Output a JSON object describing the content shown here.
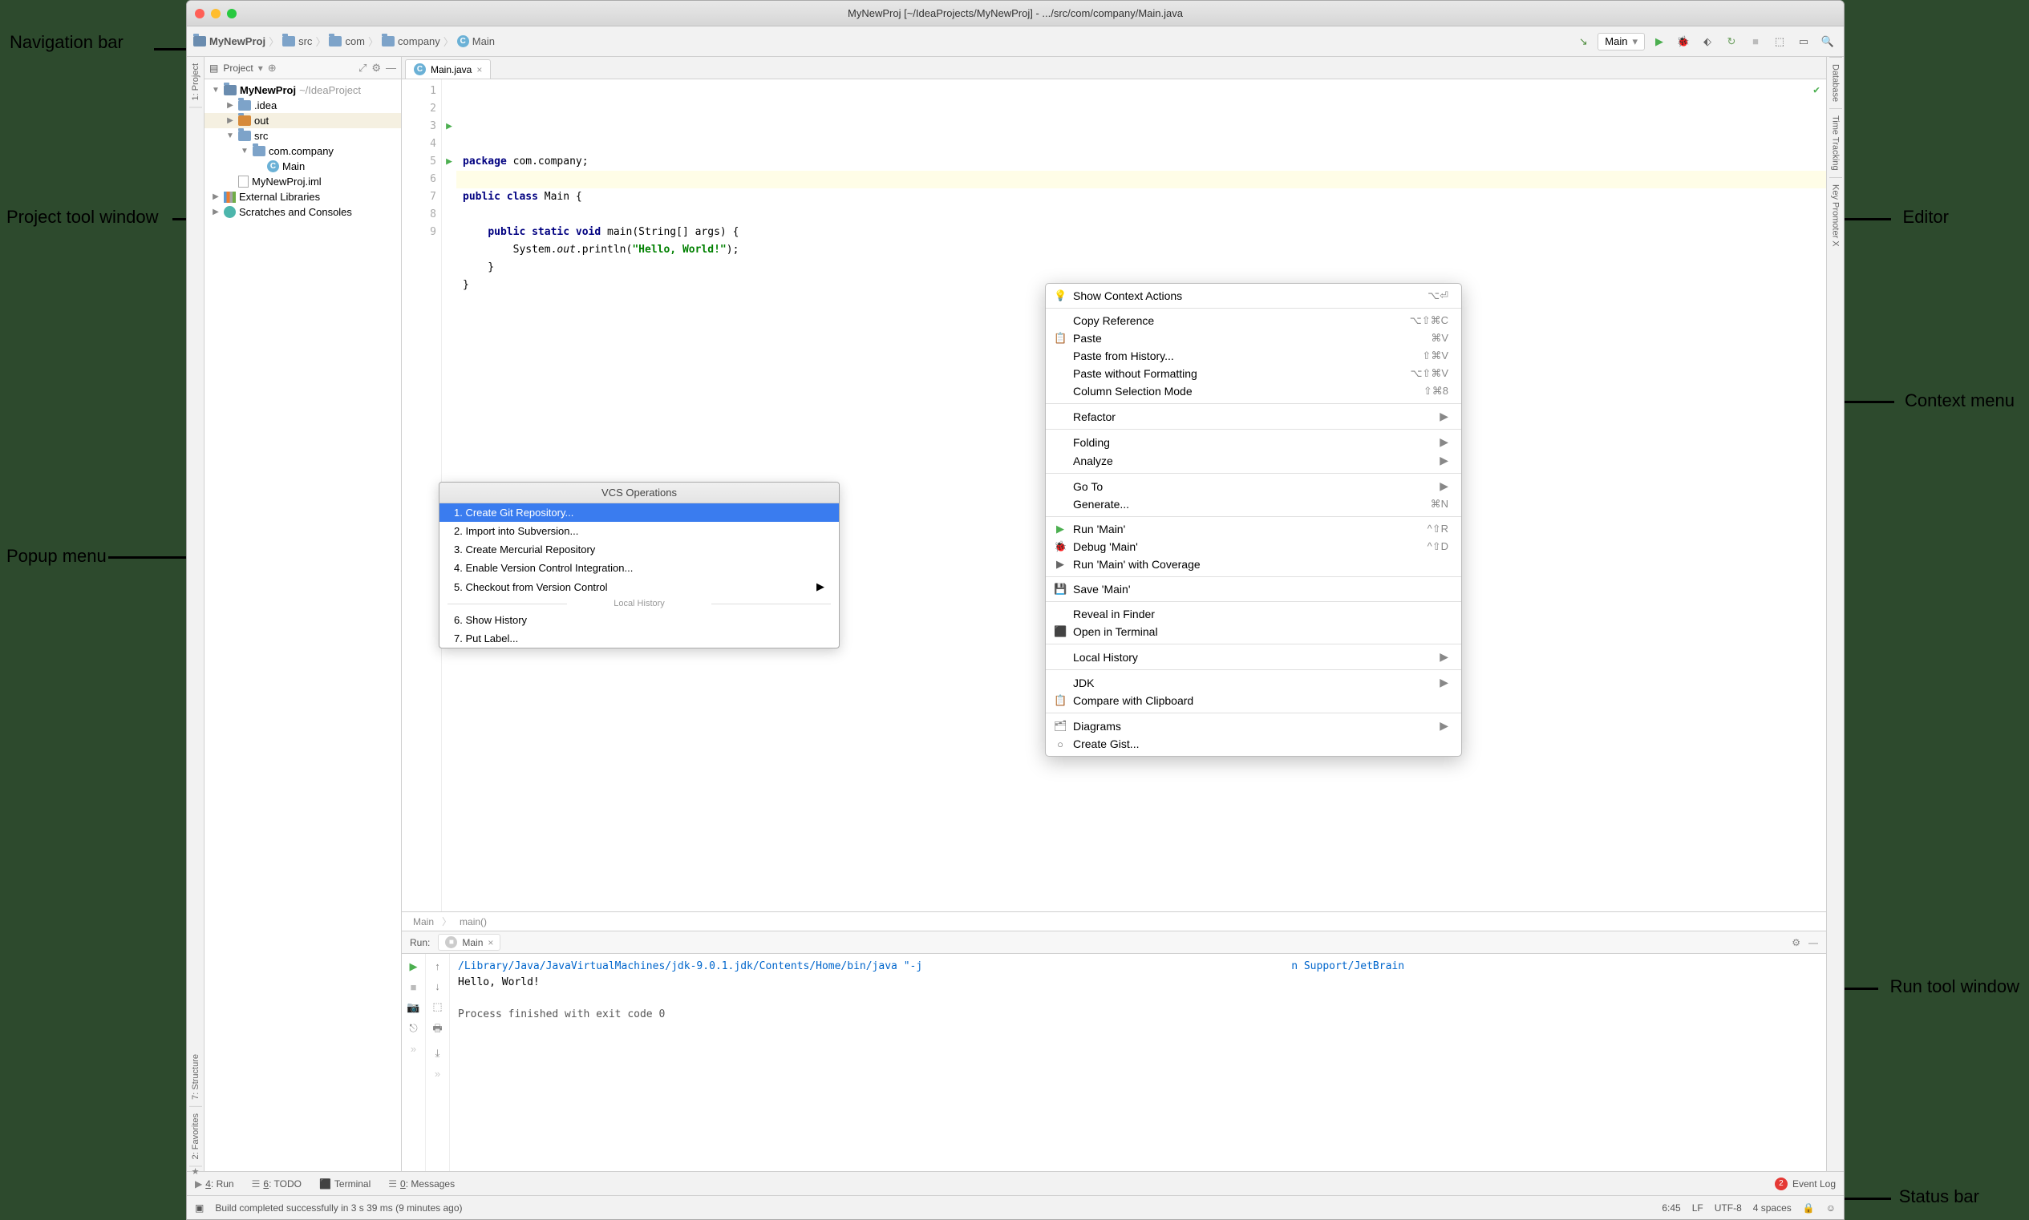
{
  "window": {
    "title": "MyNewProj [~/IdeaProjects/MyNewProj] - .../src/com/company/Main.java"
  },
  "annotations": {
    "nav_bar": "Navigation bar",
    "project_tool": "Project tool window",
    "popup_menu": "Popup menu",
    "editor": "Editor",
    "context_menu": "Context menu",
    "run_tool": "Run tool window",
    "status_bar": "Status bar"
  },
  "breadcrumbs": [
    {
      "icon": "folder-proj",
      "label": "MyNewProj",
      "bold": true
    },
    {
      "icon": "folder",
      "label": "src"
    },
    {
      "icon": "folder",
      "label": "com"
    },
    {
      "icon": "folder",
      "label": "company"
    },
    {
      "icon": "class",
      "label": "Main"
    }
  ],
  "run_config_label": "Main",
  "left_tabs": [
    "1: Project",
    "7: Structure",
    "2: Favorites"
  ],
  "right_tabs": [
    "Database",
    "Time Tracking",
    "Key Promoter X"
  ],
  "project_panel": {
    "title": "Project",
    "tree": [
      {
        "depth": 0,
        "arrow": "▼",
        "icon": "folder-proj",
        "label": "MyNewProj",
        "bold": true,
        "path": "~/IdeaProject"
      },
      {
        "depth": 1,
        "arrow": "▶",
        "icon": "folder",
        "label": ".idea"
      },
      {
        "depth": 1,
        "arrow": "▶",
        "icon": "folder-orange",
        "label": "out",
        "selected": true
      },
      {
        "depth": 1,
        "arrow": "▼",
        "icon": "folder",
        "label": "src"
      },
      {
        "depth": 2,
        "arrow": "▼",
        "icon": "folder",
        "label": "com.company"
      },
      {
        "depth": 3,
        "arrow": "",
        "icon": "class",
        "label": "Main"
      },
      {
        "depth": 1,
        "arrow": "",
        "icon": "file",
        "label": "MyNewProj.iml"
      },
      {
        "depth": 0,
        "arrow": "▶",
        "icon": "lib",
        "label": "External Libraries"
      },
      {
        "depth": 0,
        "arrow": "▶",
        "icon": "scratch",
        "label": "Scratches and Consoles"
      }
    ]
  },
  "editor": {
    "tab_label": "Main.java",
    "close": "×",
    "lines": [
      {
        "n": 1,
        "g": "",
        "html": "<span class='kw'>package</span> com.company;"
      },
      {
        "n": 2,
        "g": "",
        "html": ""
      },
      {
        "n": 3,
        "g": "▶",
        "html": "<span class='kw'>public class</span> Main {"
      },
      {
        "n": 4,
        "g": "",
        "html": ""
      },
      {
        "n": 5,
        "g": "▶",
        "html": "    <span class='kw'>public static void</span> main(String[] args) {"
      },
      {
        "n": 6,
        "g": "",
        "html": "        System.<span class='it'>out</span>.println(<span class='str'>\"Hello, World!\"</span>);",
        "hl": true
      },
      {
        "n": 7,
        "g": "",
        "html": "    }"
      },
      {
        "n": 8,
        "g": "",
        "html": "}"
      },
      {
        "n": 9,
        "g": "",
        "html": ""
      }
    ],
    "breadcrumb": [
      "Main",
      "main()"
    ]
  },
  "popup": {
    "title": "VCS Operations",
    "items": [
      {
        "label": "1. Create Git Repository...",
        "selected": true
      },
      {
        "label": "2. Import into Subversion..."
      },
      {
        "label": "3. Create Mercurial Repository"
      },
      {
        "label": "4. Enable Version Control Integration..."
      },
      {
        "label": "5. Checkout from Version Control",
        "sub": true
      }
    ],
    "sep_label": "Local History",
    "items2": [
      {
        "label": "6. Show History"
      },
      {
        "label": "7. Put Label..."
      }
    ]
  },
  "context_menu": [
    {
      "icon": "💡",
      "label": "Show Context Actions",
      "sc": "⌥⏎"
    },
    {
      "sep": true
    },
    {
      "label": "Copy Reference",
      "sc": "⌥⇧⌘C"
    },
    {
      "icon": "📋",
      "label": "Paste",
      "sc": "⌘V"
    },
    {
      "label": "Paste from History...",
      "sc": "⇧⌘V"
    },
    {
      "label": "Paste without Formatting",
      "sc": "⌥⇧⌘V"
    },
    {
      "label": "Column Selection Mode",
      "sc": "⇧⌘8"
    },
    {
      "sep": true
    },
    {
      "label": "Refactor",
      "sub": true
    },
    {
      "sep": true
    },
    {
      "label": "Folding",
      "sub": true
    },
    {
      "label": "Analyze",
      "sub": true
    },
    {
      "sep": true
    },
    {
      "label": "Go To",
      "sub": true
    },
    {
      "label": "Generate...",
      "sc": "⌘N"
    },
    {
      "sep": true
    },
    {
      "icon": "▶",
      "iconcolor": "#4caf50",
      "label": "Run 'Main'",
      "sc": "^⇧R"
    },
    {
      "icon": "🐞",
      "iconcolor": "#4caf50",
      "label": "Debug 'Main'",
      "sc": "^⇧D"
    },
    {
      "icon": "▶",
      "label": "Run 'Main' with Coverage"
    },
    {
      "sep": true
    },
    {
      "icon": "💾",
      "label": "Save 'Main'"
    },
    {
      "sep": true
    },
    {
      "label": "Reveal in Finder"
    },
    {
      "icon": "⬛",
      "label": "Open in Terminal"
    },
    {
      "sep": true
    },
    {
      "label": "Local History",
      "sub": true
    },
    {
      "sep": true
    },
    {
      "label": "JDK",
      "sub": true
    },
    {
      "icon": "📋",
      "label": "Compare with Clipboard"
    },
    {
      "sep": true
    },
    {
      "icon": "🗂",
      "label": "Diagrams",
      "sub": true
    },
    {
      "icon": "○",
      "label": "Create Gist..."
    }
  ],
  "run": {
    "header_label": "Run:",
    "tab_label": "Main",
    "output_path": "/Library/Java/JavaVirtualMachines/jdk-9.0.1.jdk/Contents/Home/bin/java \"-j",
    "output_path_tail": "n Support/JetBrain",
    "output_hello": "Hello, World!",
    "output_exit": "Process finished with exit code 0"
  },
  "bottom_tools": [
    {
      "icon": "▶",
      "label": "4: Run"
    },
    {
      "icon": "☰",
      "label": "6: TODO"
    },
    {
      "icon": "⬛",
      "label": "Terminal"
    },
    {
      "icon": "☰",
      "label": "0: Messages"
    }
  ],
  "event_log": {
    "count": "2",
    "label": "Event Log"
  },
  "status": {
    "msg": "Build completed successfully in 3 s 39 ms (9 minutes ago)",
    "pos": "6:45",
    "lf": "LF",
    "enc": "UTF-8",
    "indent": "4 spaces"
  }
}
